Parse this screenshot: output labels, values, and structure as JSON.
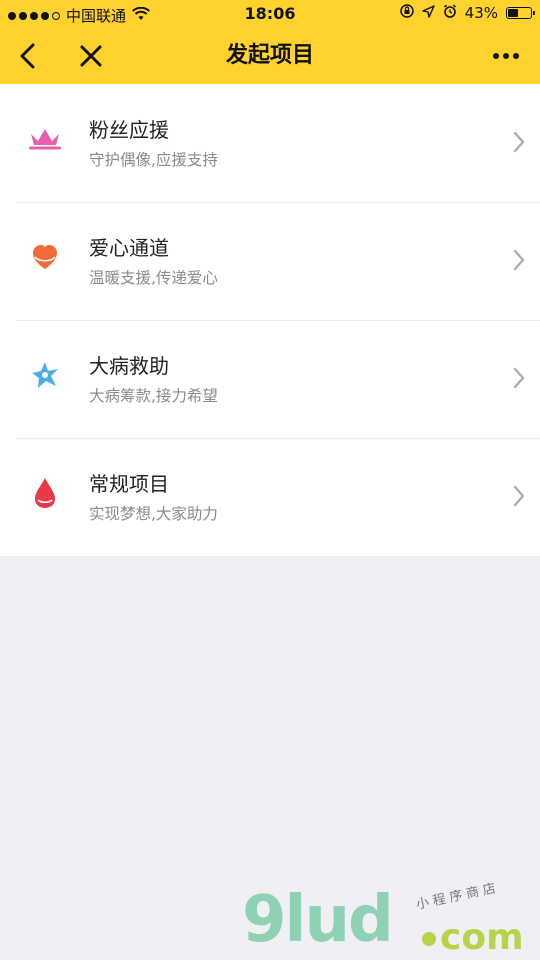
{
  "status_bar": {
    "carrier": "中国联通",
    "time": "18:06",
    "battery_percent": "43%",
    "battery_level": 0.43,
    "signal_bars_filled": 4,
    "signal_bars_total": 5
  },
  "nav": {
    "title": "发起项目",
    "back_icon": "chevron-left-icon",
    "close_icon": "close-icon",
    "more_icon": "more-icon"
  },
  "items": [
    {
      "title": "粉丝应援",
      "subtitle": "守护偶像,应援支持",
      "icon": "crown-icon",
      "icon_color": "#e85fae"
    },
    {
      "title": "爱心通道",
      "subtitle": "温暖支援,传递爱心",
      "icon": "heart-icon",
      "icon_color": "#f26a3a"
    },
    {
      "title": "大病救助",
      "subtitle": "大病筹款,接力希望",
      "icon": "star-icon",
      "icon_color": "#49aee5"
    },
    {
      "title": "常规项目",
      "subtitle": "实现梦想,大家助力",
      "icon": "drop-icon",
      "icon_color": "#e8384a"
    }
  ],
  "colors": {
    "header_bg": "#ffd22e",
    "page_bg": "#efeff4"
  },
  "watermark": {
    "logo": "9lud",
    "domain": "com",
    "tagline": "小程序商店"
  }
}
